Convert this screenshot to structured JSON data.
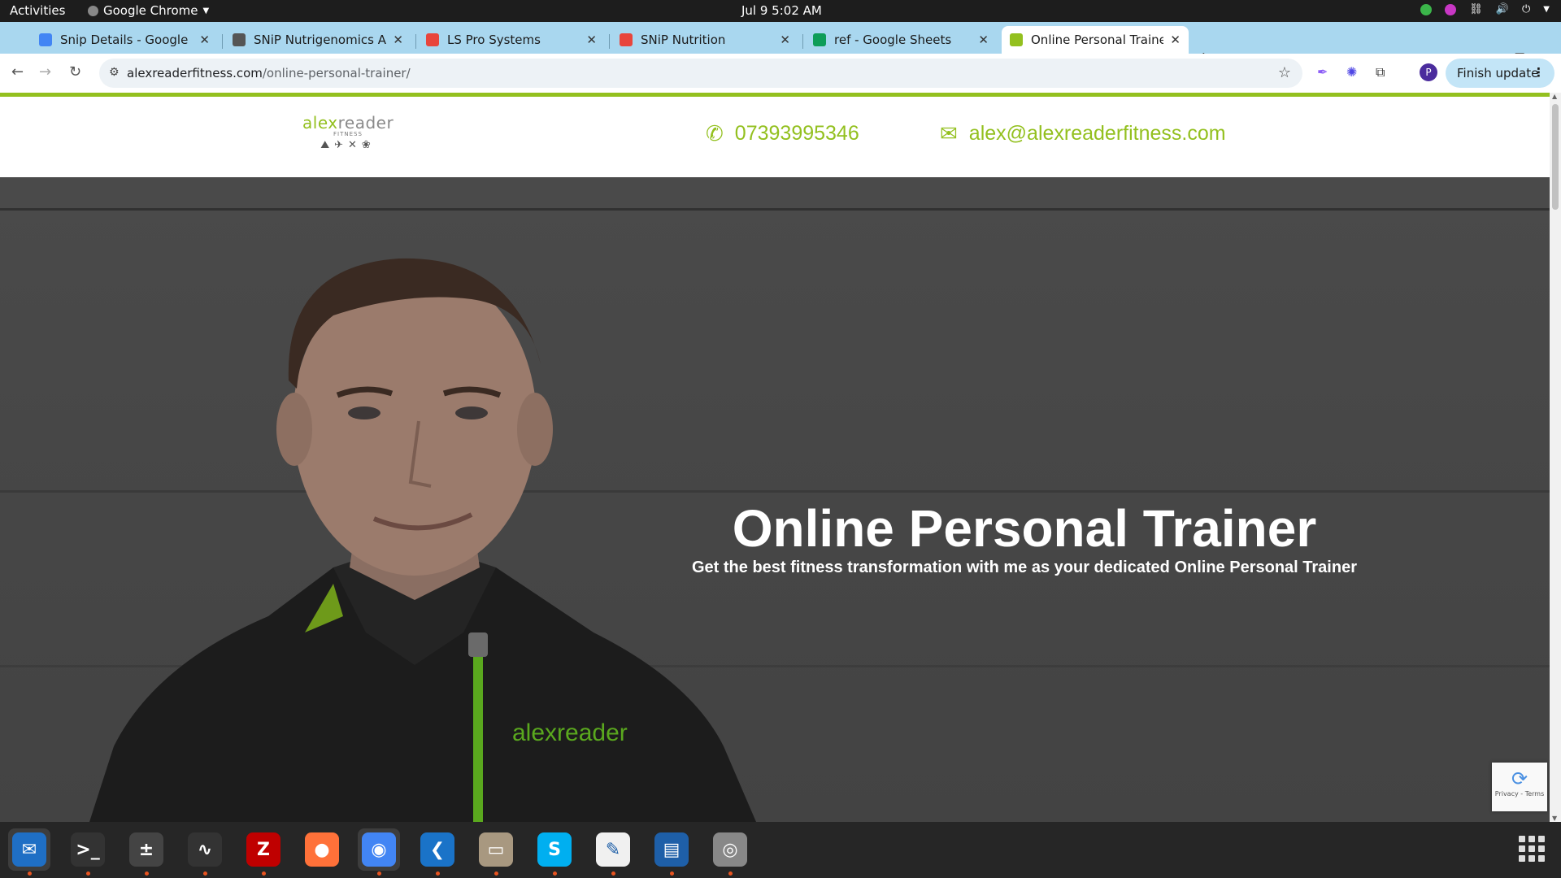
{
  "topbar": {
    "activities": "Activities",
    "app_name": "Google Chrome",
    "clock": "Jul 9  5:02 AM"
  },
  "tabs": [
    {
      "title": "Snip Details - Google Do",
      "favicon_color": "#4285f4",
      "active": false
    },
    {
      "title": "SNiP Nutrigenomics Adm",
      "favicon_color": "#555555",
      "active": false
    },
    {
      "title": "LS Pro Systems",
      "favicon_color": "#e8453c",
      "active": false
    },
    {
      "title": "SNiP Nutrition",
      "favicon_color": "#e8453c",
      "active": false
    },
    {
      "title": "ref - Google Sheets",
      "favicon_color": "#0f9d58",
      "active": false
    },
    {
      "title": "Online Personal Trainer |",
      "favicon_color": "#93c01f",
      "active": true
    }
  ],
  "toolbar": {
    "url_host": "alexreaderfitness.com",
    "url_path": "/online-personal-trainer/",
    "profile_initial": "P",
    "finish_update": "Finish update"
  },
  "site": {
    "logo_alex": "alex",
    "logo_reader": "reader",
    "logo_sub": "FITNESS",
    "phone": "07393995346",
    "email": "alex@alexreaderfitness.com",
    "accent_color": "#93c01f",
    "hero_title": "Online Personal Trainer",
    "hero_subtitle": "Get the best fitness transformation with me as your dedicated Online Personal Trainer",
    "jacket_logo": "alexreader",
    "recaptcha_text": "Privacy - Terms"
  },
  "dock": [
    {
      "name": "thunderbird-icon",
      "glyph": "✉",
      "bg": "#1f6fc5",
      "running": true,
      "selected": true
    },
    {
      "name": "terminal-icon",
      "glyph": ">_",
      "bg": "#333333",
      "running": true,
      "selected": false
    },
    {
      "name": "calculator-icon",
      "glyph": "±",
      "bg": "#444444",
      "running": true,
      "selected": false
    },
    {
      "name": "system-monitor-icon",
      "glyph": "∿",
      "bg": "#333333",
      "running": true,
      "selected": false
    },
    {
      "name": "filezilla-icon",
      "glyph": "Z",
      "bg": "#bf0000",
      "running": true,
      "selected": false
    },
    {
      "name": "firefox-icon",
      "glyph": "●",
      "bg": "#ff7139",
      "running": false,
      "selected": false
    },
    {
      "name": "chrome-icon",
      "glyph": "◉",
      "bg": "#4285f4",
      "running": true,
      "selected": true
    },
    {
      "name": "vscode-icon",
      "glyph": "❮",
      "bg": "#1a73c8",
      "running": true,
      "selected": false
    },
    {
      "name": "files-icon",
      "glyph": "▭",
      "bg": "#a89880",
      "running": true,
      "selected": false
    },
    {
      "name": "skype-icon",
      "glyph": "S",
      "bg": "#00aff0",
      "running": true,
      "selected": false
    },
    {
      "name": "text-editor-icon",
      "glyph": "✎",
      "bg": "#f0f0f0",
      "running": true,
      "selected": false
    },
    {
      "name": "document-viewer-icon",
      "glyph": "▤",
      "bg": "#1e5fa8",
      "running": true,
      "selected": false
    },
    {
      "name": "disk-icon",
      "glyph": "◎",
      "bg": "#888888",
      "running": true,
      "selected": false
    }
  ]
}
